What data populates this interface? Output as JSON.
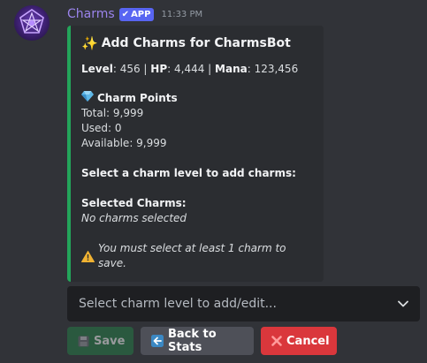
{
  "message": {
    "author": "Charms",
    "badge": "APP",
    "timestamp": "11:33 PM"
  },
  "embed": {
    "accent_color": "#23a55a",
    "title": "Add Charms for CharmsBot",
    "stats": {
      "level_label": "Level",
      "level_value": ": 456 | ",
      "hp_label": "HP",
      "hp_value": ": 4,444 | ",
      "mana_label": "Mana",
      "mana_value": ": 123,456"
    },
    "charm_points": {
      "heading": "Charm Points",
      "total": "Total: 9,999",
      "used": "Used: 0",
      "available": "Available: 9,999"
    },
    "select_prompt": "Select a charm level to add charms:",
    "selected_heading": "Selected Charms:",
    "selected_value": "No charms selected",
    "warning": "You must select at least 1 charm to save."
  },
  "select_menu": {
    "placeholder": "Select charm level to add/edit..."
  },
  "buttons": {
    "save": "Save",
    "back": "Back to Stats",
    "cancel": "Cancel"
  },
  "colors": {
    "save": "#248046",
    "back": "#4e5058",
    "cancel": "#da373c",
    "badge": "#5865f2"
  }
}
